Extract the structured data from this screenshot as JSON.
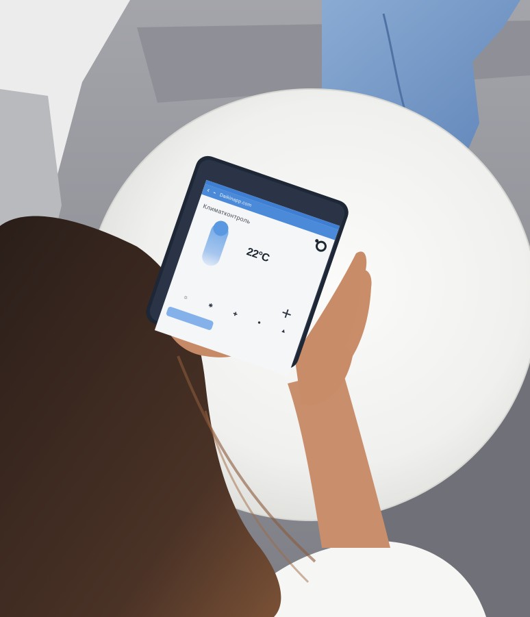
{
  "app": {
    "url": "Daikinapp.com",
    "heading": "Климатконтроль",
    "temperature": "22°C",
    "sub_label": "",
    "row_label": "",
    "bottom_label": "",
    "footer": ""
  },
  "icons": {
    "back": "chevron-left-icon",
    "plus": "plus-icon",
    "logo": "brand-logo-icon",
    "modes": [
      "sun-icon",
      "snowflake-icon",
      "fan-icon",
      "drop-icon",
      "triangle-icon"
    ]
  },
  "glyphs": {
    "back": "‹",
    "lock": "⌁",
    "plus": "+",
    "modes": [
      "☼",
      "✱",
      "✚",
      "●",
      "▲"
    ]
  },
  "colors": {
    "app_bar": "#4a8ad8",
    "dial": "#5b98e2",
    "sofa": "#8e8f96",
    "pillow": "#f3f3f1",
    "jeans": "#6e93c4",
    "hair": "#3b2a22",
    "phone_case": "#1e2736"
  }
}
